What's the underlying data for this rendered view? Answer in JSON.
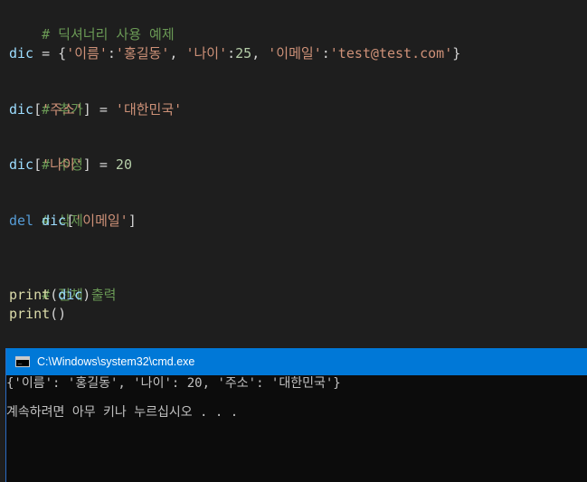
{
  "editor": {
    "line1": {
      "comment": "# 딕셔너리 사용 예제"
    },
    "line2": {
      "var": "dic",
      "op": " = {",
      "k1": "'이름'",
      "c1": ":",
      "v1": "'홍길동'",
      "s1": ", ",
      "k2": "'나이'",
      "c2": ":",
      "v2": "25",
      "s2": ", ",
      "k3": "'이메일'",
      "c3": ":",
      "v3": "'test@test.com'",
      "end": "}"
    },
    "line3": {
      "comment": "# 추가"
    },
    "line4": {
      "var": "dic",
      "open": "[",
      "key": "'주소'",
      "mid": "] = ",
      "val": "'대한민국'"
    },
    "line5": {
      "comment": "# 수정"
    },
    "line6": {
      "var": "dic",
      "open": "[",
      "key": "'나이'",
      "mid": "] = ",
      "val": "20"
    },
    "line7": {
      "comment": "# 삭제"
    },
    "line8": {
      "kw": "del",
      "sp": " ",
      "var": "dic",
      "open": "[",
      "key": "'이메일'",
      "close": "]"
    },
    "line9": {
      "comment": "# 전체 출력"
    },
    "line10": {
      "fn": "print",
      "open": "(",
      "arg": "dic",
      "close": ")"
    },
    "line11": {
      "fn": "print",
      "parens": "()"
    }
  },
  "console": {
    "title": "C:\\Windows\\system32\\cmd.exe",
    "output_line1": "{'이름': '홍길동', '나이': 20, '주소': '대한민국'}",
    "output_line2": "계속하려면 아무 키나 누르십시오 . . ."
  },
  "colors": {
    "editor_bg": "#1e1e1e",
    "comment": "#6a9955",
    "string": "#ce9178",
    "number": "#b5cea8",
    "keyword": "#569cd6",
    "console_titlebar": "#0078d7",
    "console_bg": "#0c0c0c"
  }
}
